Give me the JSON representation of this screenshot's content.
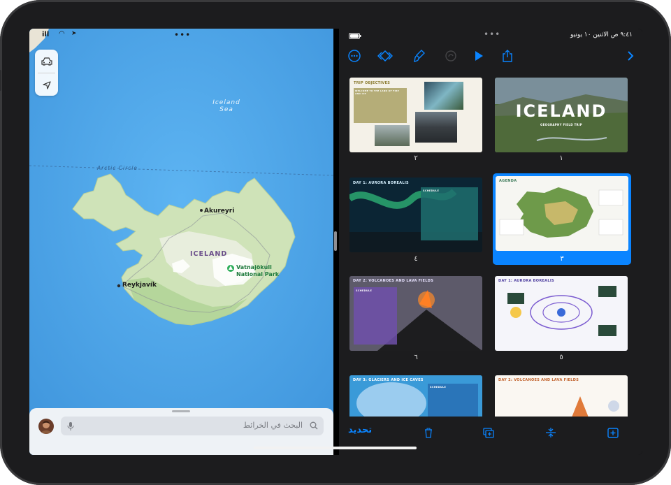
{
  "maps": {
    "status": {
      "time": "",
      "signal_text": "ill"
    },
    "sea_label_line1": "Iceland",
    "sea_label_line2": "Sea",
    "arctic_circle_label": "Arctic Circle",
    "island_label": "ICELAND",
    "towns": [
      "Akureyri",
      "Reykjavík"
    ],
    "park_label_line1": "Vatnajökull",
    "park_label_line2": "National Park",
    "search_placeholder": "البحث في الخرائط"
  },
  "keynote": {
    "status_time": "٩:٤١ ص  الاثنين ١٠ يونيو",
    "toolbar_icons": [
      "more-icon",
      "animate-icon",
      "format-brush-icon",
      "undo-icon",
      "play-icon",
      "share-icon",
      "chevron-right-icon"
    ],
    "slides": [
      {
        "number": "١",
        "title": "ICELAND",
        "subtitle": "GEOGRAPHY FIELD TRIP"
      },
      {
        "number": "٢",
        "title": "TRIP OBJECTIVES",
        "subtitle": "WELCOME TO THE LAND OF FIRE AND ICE"
      },
      {
        "number": "٣",
        "title": "AGENDA",
        "subtitle": ""
      },
      {
        "number": "٤",
        "title": "DAY 1: AURORA BOREALIS",
        "subtitle": "SCHEDULE"
      },
      {
        "number": "٥",
        "title": "DAY 1: AURORA BOREALIS",
        "subtitle": ""
      },
      {
        "number": "٦",
        "title": "DAY 2: VOLCANOES AND LAVA FIELDS",
        "subtitle": "SCHEDULE"
      },
      {
        "number": "",
        "title": "DAY 2: VOLCANOES AND LAVA FIELDS",
        "subtitle": ""
      },
      {
        "number": "",
        "title": "DAY 3: GLACIERS AND ICE CAVES",
        "subtitle": "SCHEDULE"
      }
    ],
    "bottom_select_label": "تحديد",
    "bottom_icons": [
      "delete-icon",
      "duplicate-icon",
      "skip-icon",
      "add-slide-icon"
    ]
  },
  "colors": {
    "accent": "#0a84ff",
    "ocean": "#4aa3ea",
    "selection": "#0a84ff"
  }
}
